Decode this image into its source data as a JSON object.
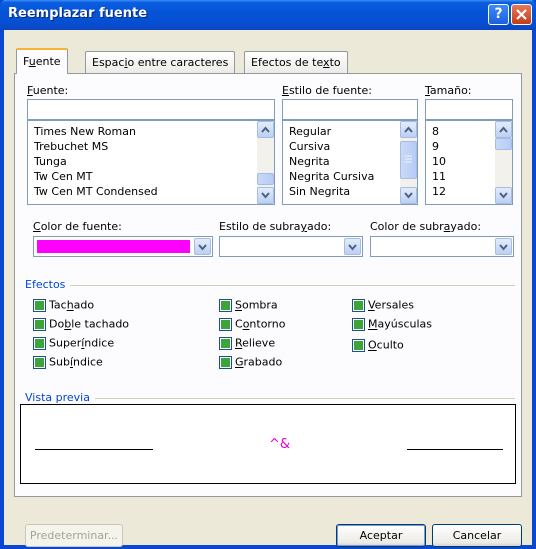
{
  "window": {
    "title": "Reemplazar fuente"
  },
  "tabs": [
    {
      "label_pre": "F",
      "label_key": "u",
      "label_post": "ente"
    },
    {
      "label_pre": "Espac",
      "label_key": "i",
      "label_post": "o entre caracteres"
    },
    {
      "label_pre": "Efectos de te",
      "label_key": "x",
      "label_post": "to"
    }
  ],
  "font": {
    "label_key": "F",
    "label_post": "uente:",
    "value": "",
    "options": [
      "Times New Roman",
      "Trebuchet MS",
      "Tunga",
      "Tw Cen MT",
      "Tw Cen MT Condensed"
    ]
  },
  "style": {
    "label_key": "E",
    "label_post": "stilo de fuente:",
    "value": "",
    "options": [
      "Regular",
      "Cursiva",
      "Negrita",
      "Negrita Cursiva",
      "Sin Negrita"
    ]
  },
  "size": {
    "label_key": "T",
    "label_post": "amaño:",
    "value": "",
    "options": [
      "8",
      "9",
      "10",
      "11",
      "12"
    ]
  },
  "font_color": {
    "label_pre": "",
    "label_key": "C",
    "label_post": "olor de fuente:",
    "value": "#ff00ff"
  },
  "underline_style": {
    "label_pre": "Estilo de subra",
    "label_key": "y",
    "label_post": "ado:",
    "value": ""
  },
  "underline_color": {
    "label_pre": "Color de subr",
    "label_key": "a",
    "label_post": "yado:",
    "value": ""
  },
  "effects": {
    "title": "Efectos",
    "items": [
      {
        "pre": "Tac",
        "key": "h",
        "post": "ado"
      },
      {
        "pre": "Do",
        "key": "b",
        "post": "le tachado"
      },
      {
        "pre": "Super",
        "key": "í",
        "post": "ndice"
      },
      {
        "pre": "Sub",
        "key": "í",
        "post": "ndice"
      },
      {
        "pre": "",
        "key": "S",
        "post": "ombra"
      },
      {
        "pre": "C",
        "key": "o",
        "post": "ntorno"
      },
      {
        "pre": "",
        "key": "R",
        "post": "elieve"
      },
      {
        "pre": "",
        "key": "G",
        "post": "rabado"
      },
      {
        "pre": "",
        "key": "V",
        "post": "ersales"
      },
      {
        "pre": "",
        "key": "M",
        "post": "ayúsculas"
      },
      {
        "pre": "",
        "key": "O",
        "post": "culto"
      }
    ]
  },
  "preview": {
    "title": "Vista previa",
    "sample": "^&"
  },
  "buttons": {
    "default": "Predeterminar...",
    "ok": "Aceptar",
    "cancel": "Cancelar"
  },
  "colors": {
    "title_bar": "#0553d6",
    "accent_tab": "#f8b334",
    "group_title": "#0046d5",
    "checkbox_fill": "#3ba43b"
  }
}
